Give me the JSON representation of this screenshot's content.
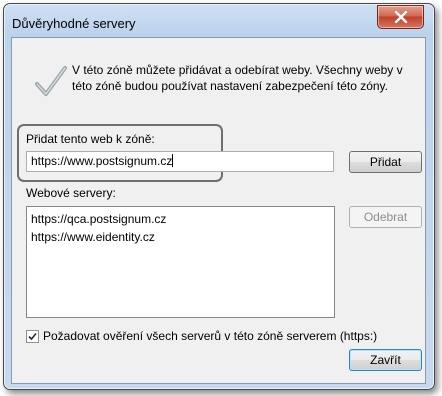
{
  "window": {
    "title": "Důvěryhodné servery"
  },
  "description": "V této zóně můžete přidávat a odebírat weby. Všechny weby v této zóně budou používat nastavení zabezpečení této zóny.",
  "add_site": {
    "label": "Přidat tento web k zóně:",
    "value": "https://www.postsignum.cz",
    "button_label": "Přidat"
  },
  "websites": {
    "label": "Webové servery:",
    "items": [
      "https://qca.postsignum.cz",
      "https://www.eidentity.cz"
    ],
    "remove_label": "Odebrat"
  },
  "require_https": {
    "checked": true,
    "label": "Požadovat ověření všech serverů v této zóně serverem (https:)"
  },
  "close_label": "Zavřít",
  "colors": {
    "close_button": "#c1412a",
    "title_bar": "#bcd3ec"
  },
  "icons": [
    "close-icon",
    "checkmark-icon",
    "checkbox-checked-icon"
  ]
}
